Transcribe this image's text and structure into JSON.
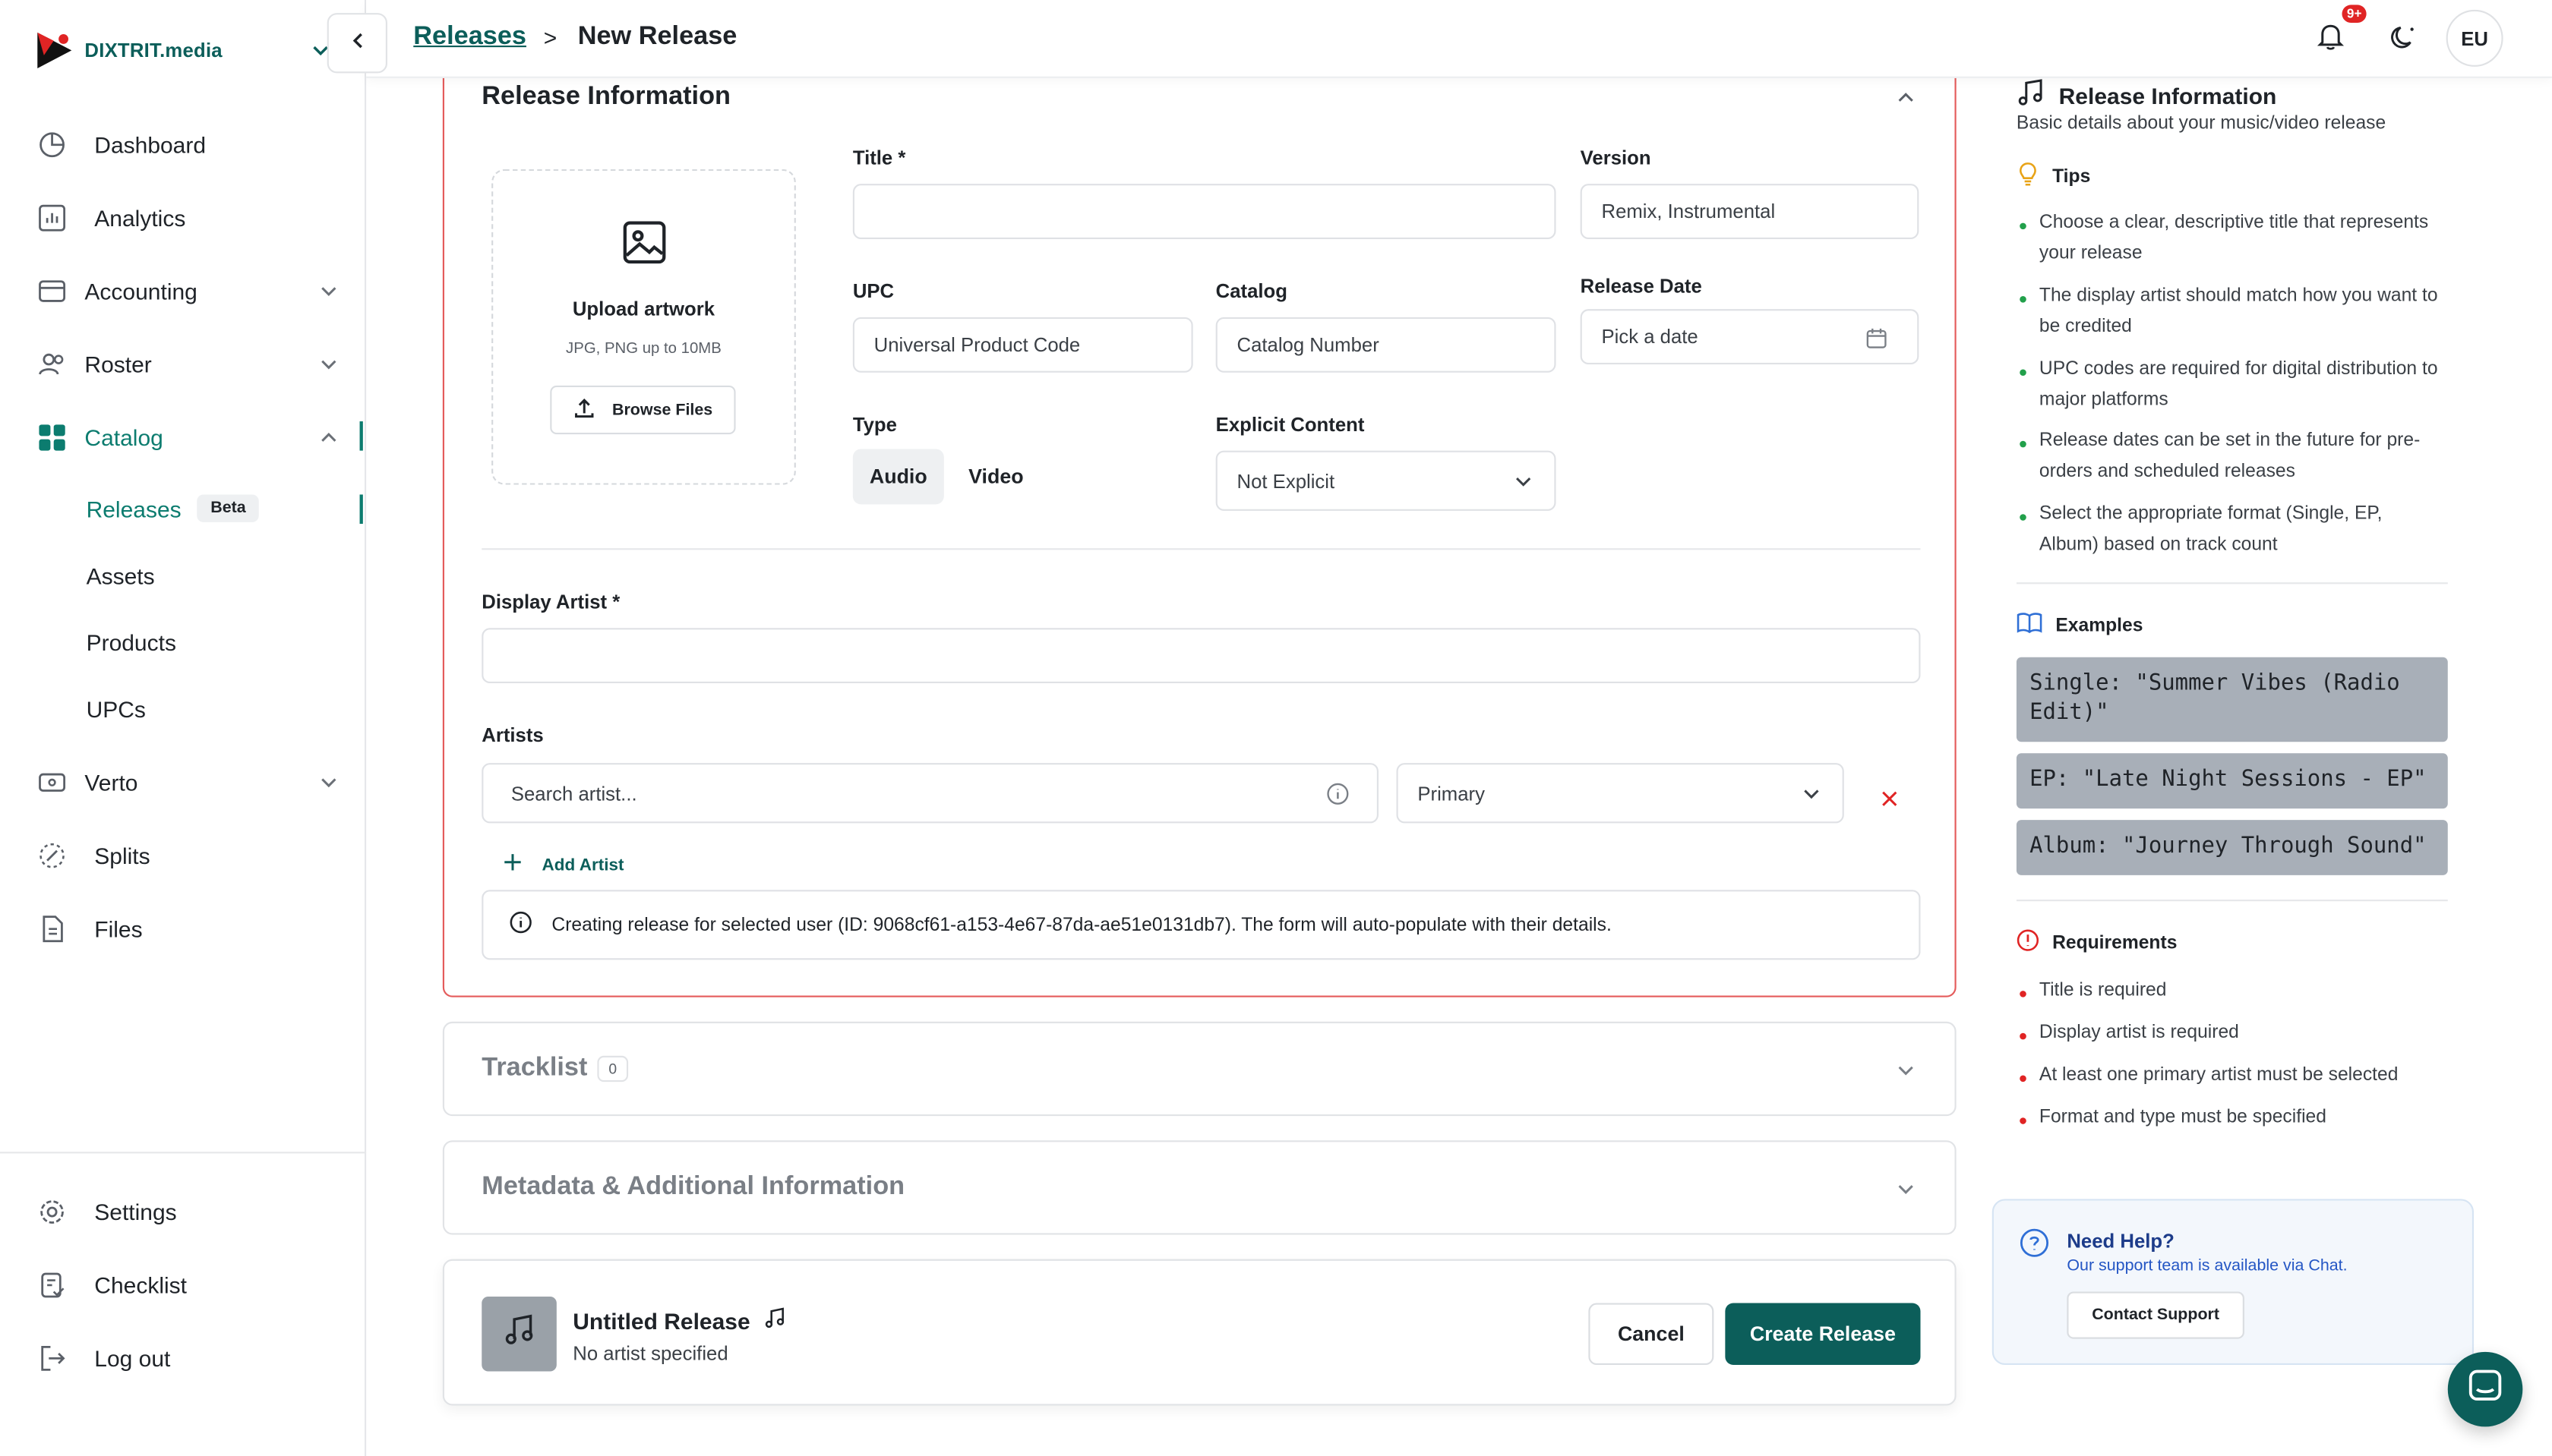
{
  "brand": {
    "name": "DIXTRIT.media"
  },
  "sidebar": {
    "items": [
      {
        "label": "Dashboard",
        "icon": "chart-pie-icon"
      },
      {
        "label": "Analytics",
        "icon": "bar-chart-icon"
      },
      {
        "label": "Accounting",
        "icon": "wallet-icon"
      },
      {
        "label": "Roster",
        "icon": "users-icon"
      },
      {
        "label": "Catalog",
        "icon": "grid-icon"
      },
      {
        "label": "Verto",
        "icon": "ticket-icon"
      },
      {
        "label": "Splits",
        "icon": "split-icon"
      },
      {
        "label": "Files",
        "icon": "file-icon"
      }
    ],
    "catalog_sub": [
      "Releases",
      "Assets",
      "Products",
      "UPCs"
    ],
    "beta_label": "Beta",
    "bottom": [
      {
        "label": "Settings",
        "icon": "gear-icon"
      },
      {
        "label": "Checklist",
        "icon": "clipboard-check-icon"
      },
      {
        "label": "Log out",
        "icon": "logout-icon"
      }
    ]
  },
  "header": {
    "breadcrumb_link": "Releases",
    "breadcrumb_sep": ">",
    "breadcrumb_current": "New Release",
    "notification_badge": "9+",
    "avatar_initials": "EU"
  },
  "form": {
    "section_title": "Release Information",
    "upload": {
      "title": "Upload artwork",
      "subtitle": "JPG, PNG up to 10MB",
      "button": "Browse Files"
    },
    "title_label": "Title *",
    "title_value": "",
    "version_label": "Version",
    "version_placeholder": "Remix, Instrumental",
    "upc_label": "UPC",
    "upc_placeholder": "Universal Product Code",
    "catalog_label": "Catalog",
    "catalog_placeholder": "Catalog Number",
    "release_date_label": "Release Date",
    "release_date_placeholder": "Pick a date",
    "type_label": "Type",
    "type_options": [
      "Audio",
      "Video"
    ],
    "type_selected": "Audio",
    "explicit_label": "Explicit Content",
    "explicit_value": "Not Explicit",
    "display_artist_label": "Display Artist *",
    "display_artist_value": "",
    "artists_label": "Artists",
    "artist_search_placeholder": "Search artist...",
    "artist_role": "Primary",
    "add_artist": "Add Artist",
    "info_message": "Creating release for selected user (ID: 9068cf61-a153-4e67-87da-ae51e0131db7). The form will auto-populate with their details."
  },
  "sections": {
    "tracklist": {
      "title": "Tracklist",
      "count": "0"
    },
    "metadata": {
      "title": "Metadata & Additional Information"
    }
  },
  "footer": {
    "release_title": "Untitled Release",
    "release_sub": "No artist specified",
    "cancel": "Cancel",
    "create": "Create Release"
  },
  "right_panel": {
    "title": "Release Information",
    "subtitle": "Basic details about your music/video release",
    "tips_title": "Tips",
    "tips": [
      "Choose a clear, descriptive title that represents your release",
      "The display artist should match how you want to be credited",
      "UPC codes are required for digital distribution to major platforms",
      "Release dates can be set in the future for pre-orders and scheduled releases",
      "Select the appropriate format (Single, EP, Album) based on track count"
    ],
    "examples_title": "Examples",
    "examples": [
      "Single: \"Summer Vibes (Radio Edit)\"",
      "EP: \"Late Night Sessions - EP\"",
      "Album: \"Journey Through Sound\""
    ],
    "requirements_title": "Requirements",
    "requirements": [
      "Title is required",
      "Display artist is required",
      "At least one primary artist must be selected",
      "Format and type must be specified"
    ],
    "help": {
      "title": "Need Help?",
      "subtitle": "Our support team is available via Chat.",
      "button": "Contact Support"
    }
  },
  "colors": {
    "brand": "#0c5e5a",
    "accent": "#0c7c6f",
    "error_border": "#e45b5b",
    "tip_dot": "#22a04b",
    "requirement_dot": "#e02424"
  }
}
